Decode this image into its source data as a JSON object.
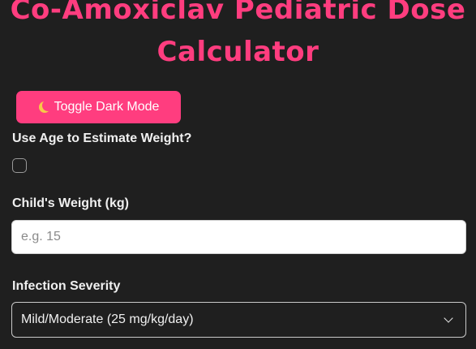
{
  "header": {
    "title_line1": "Co-Amoxiclav Pediatric Dose",
    "title_line2": "Calculator"
  },
  "toolbar": {
    "toggle_icon": "moon-icon",
    "toggle_label": "Toggle Dark Mode"
  },
  "form": {
    "use_age_label": "Use Age to Estimate Weight?",
    "use_age_checked": false,
    "weight_label": "Child's Weight (kg)",
    "weight_value": "",
    "weight_placeholder": "e.g. 15",
    "severity_label": "Infection Severity",
    "severity_selected": "Mild/Moderate (25 mg/kg/day)"
  },
  "colors": {
    "accent": "#ff3d7f",
    "background": "#1f1f1f"
  }
}
